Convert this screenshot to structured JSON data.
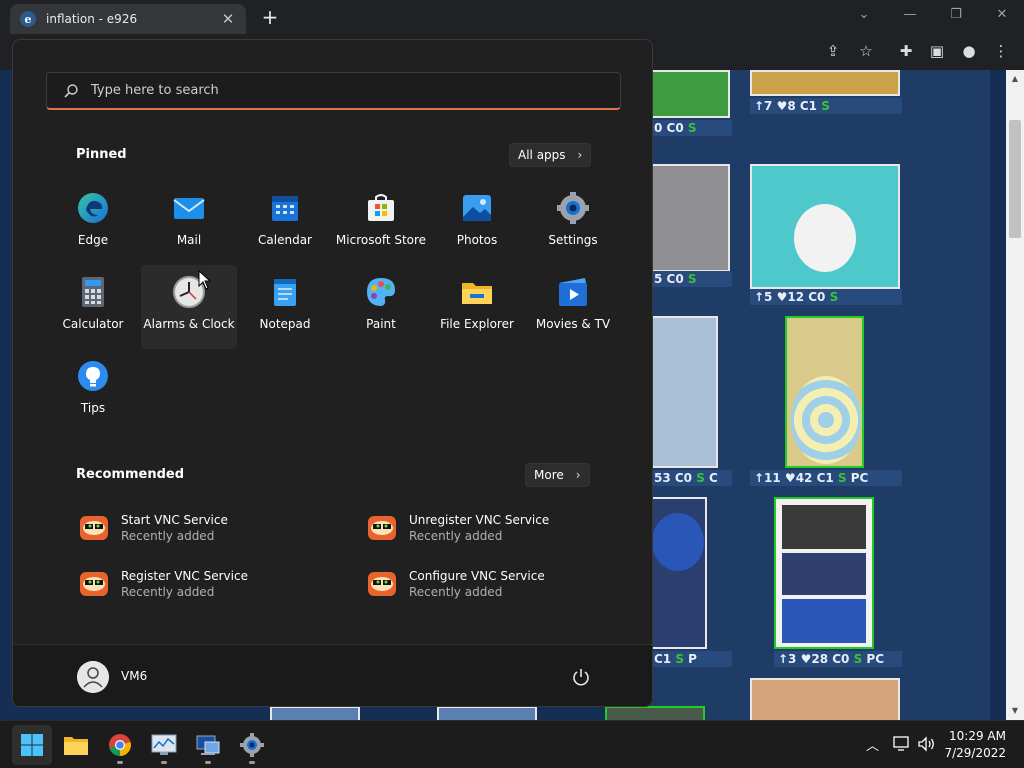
{
  "browser": {
    "tab_title": "inflation - e926",
    "tab_favicon": "e",
    "new_tab": "+",
    "close_tab": "✕",
    "minimize": "—",
    "restore": "❐",
    "close_window": "✕"
  },
  "page": {
    "stats": [
      {
        "text": "0 C0 ",
        "s": "S",
        "tail": ""
      },
      {
        "text": "↑7 ♥8 C1 ",
        "s": "S",
        "tail": ""
      },
      {
        "text": "5 C0 ",
        "s": "S",
        "tail": ""
      },
      {
        "text": "↑5 ♥12 C0 ",
        "s": "S",
        "tail": ""
      },
      {
        "text": "53 C0 ",
        "s": "S",
        "tail": " C"
      },
      {
        "text": "↑11 ♥42 C1 ",
        "s": "S",
        "tail": " PC"
      },
      {
        "text": " C1 ",
        "s": "S",
        "tail": " P"
      },
      {
        "text": "↑3 ♥28 C0 ",
        "s": "S",
        "tail": " PC"
      }
    ]
  },
  "start_menu": {
    "search_placeholder": "Type here to search",
    "pinned_title": "Pinned",
    "all_apps": "All apps",
    "pinned": [
      {
        "label": "Edge",
        "icon": "edge-icon"
      },
      {
        "label": "Mail",
        "icon": "mail-icon"
      },
      {
        "label": "Calendar",
        "icon": "calendar-icon"
      },
      {
        "label": "Microsoft Store",
        "icon": "store-icon"
      },
      {
        "label": "Photos",
        "icon": "photos-icon"
      },
      {
        "label": "Settings",
        "icon": "settings-icon"
      },
      {
        "label": "Calculator",
        "icon": "calculator-icon"
      },
      {
        "label": "Alarms & Clock",
        "icon": "clock-icon"
      },
      {
        "label": "Notepad",
        "icon": "notepad-icon"
      },
      {
        "label": "Paint",
        "icon": "paint-icon"
      },
      {
        "label": "File Explorer",
        "icon": "folder-icon"
      },
      {
        "label": "Movies & TV",
        "icon": "movies-icon"
      },
      {
        "label": "Tips",
        "icon": "tips-icon"
      }
    ],
    "recommended_title": "Recommended",
    "more": "More",
    "recommended": [
      {
        "name": "Start VNC Service",
        "sub": "Recently added"
      },
      {
        "name": "Unregister VNC Service",
        "sub": "Recently added"
      },
      {
        "name": "Register VNC Service",
        "sub": "Recently added"
      },
      {
        "name": "Configure VNC Service",
        "sub": "Recently added"
      }
    ],
    "user": "VM6"
  },
  "taskbar": {
    "time": "10:29 AM",
    "date": "7/29/2022"
  },
  "colors": {
    "accent": "#e0714d",
    "start_bg": "#202020",
    "taskbar_bg": "#1c1c1c"
  }
}
